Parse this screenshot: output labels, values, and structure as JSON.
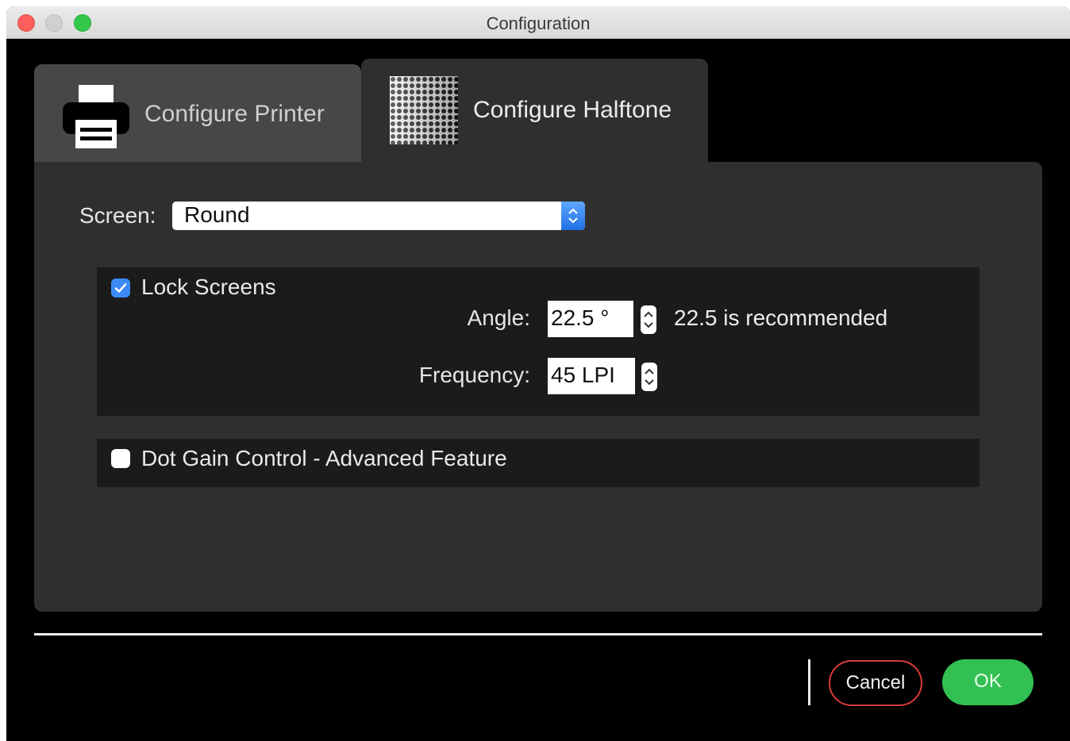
{
  "window": {
    "title": "Configuration"
  },
  "tabs": [
    {
      "label": "Configure Printer",
      "icon": "printer-icon",
      "active": false
    },
    {
      "label": "Configure Halftone",
      "icon": "halftone-icon",
      "active": true
    }
  ],
  "screen": {
    "label": "Screen:",
    "value": "Round"
  },
  "lock_screens": {
    "label": "Lock Screens",
    "checked": true,
    "angle": {
      "label": "Angle:",
      "value": "22.5 °",
      "hint": "22.5 is recommended"
    },
    "frequency": {
      "label": "Frequency:",
      "value": "45 LPI"
    }
  },
  "dot_gain": {
    "label": "Dot Gain Control - Advanced Feature",
    "checked": false
  },
  "footer": {
    "cancel_label": "Cancel",
    "ok_label": "OK"
  },
  "colors": {
    "accent": "#3b8af6",
    "ok": "#33c053",
    "cancel_border": "#d93b3b"
  }
}
